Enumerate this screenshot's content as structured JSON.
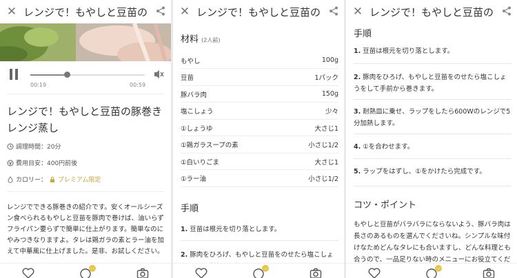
{
  "topbar": {
    "close_symbol": "✕",
    "title": "レンジで！もやしと豆苗の",
    "share_icon": "share-icon"
  },
  "player": {
    "current_time": "00:19",
    "total_time": "00:59",
    "progress": 0.32
  },
  "recipe": {
    "title": "レンジで！もやしと豆苗の豚巻きレンジ蒸し",
    "cook_time": "調理時間：20分",
    "cost": "費用目安：400円前後",
    "calorie_label": "カロリー：",
    "calorie_value": "プレミアム限定",
    "description": "レンジでできる豚巻きの紹介です。安くオールシーズン食べられるもやしと豆苗を豚肉で巻けば、油いらずフライパン要らずで簡単に仕上がります。簡単なのにやみつきなりますよ。タレは鶏ガラの素とラー油を加えて中華風に仕上げました。是非、お試しください。"
  },
  "ingredients": {
    "heading": "材料",
    "servings": "(2人前)",
    "items": [
      {
        "name": "もやし",
        "amount": "100g"
      },
      {
        "name": "豆苗",
        "amount": "1パック"
      },
      {
        "name": "豚バラ肉",
        "amount": "150g"
      },
      {
        "name": "塩こしょう",
        "amount": "少々"
      },
      {
        "name": "①しょうゆ",
        "amount": "大さじ1"
      },
      {
        "name": "①鶏ガラスープの素",
        "amount": "小さじ1/2"
      },
      {
        "name": "①白いりごま",
        "amount": "大さじ1"
      },
      {
        "name": "①ラー油",
        "amount": "小さじ1/2"
      }
    ]
  },
  "steps_heading": "手順",
  "steps": [
    {
      "num": "1.",
      "text": "豆苗は根元を切り落とします。"
    },
    {
      "num": "2.",
      "text": "豚肉をひろげ、もやしと豆苗をのせたら塩こしょうをして手前から巻きます。"
    },
    {
      "num": "3.",
      "text": "耐熱皿に乗せ、ラップをしたら600Wのレンジで5分加熱します。"
    },
    {
      "num": "4.",
      "text": "①を合わせます。"
    },
    {
      "num": "5.",
      "text": "ラップをはずし、①をかけたら完成です。"
    }
  ],
  "tips": {
    "heading": "コツ・ポイント",
    "text": "もやしと豆苗がバラバラにならないよう、豚バラ肉は長さのあるものを選んでくださいね。シンプルな味付けなためどんなタレにも合いますし、どんな料理とも合うので、一品足りない時のメニューにお役立てください。"
  },
  "bottom": {
    "like_icon": "heart-icon",
    "comment_icon": "comment-icon",
    "comment_badge": "...",
    "camera_icon": "camera-icon"
  },
  "colors": {
    "premium": "#c7a63a",
    "badge": "#e8c64a"
  }
}
